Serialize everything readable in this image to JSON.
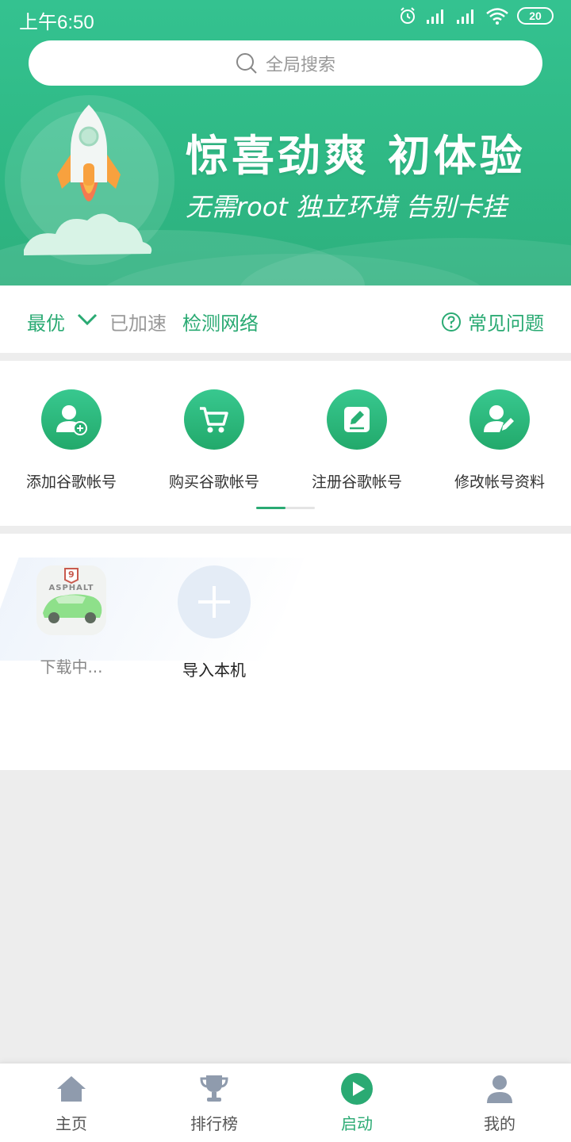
{
  "status_bar": {
    "time": "上午6:50",
    "battery": "20"
  },
  "search": {
    "placeholder": "全局搜索"
  },
  "banner": {
    "title": "惊喜劲爽  初体验",
    "subtitle": "无需root  独立环境  告别卡挂"
  },
  "network": {
    "mode": "最优",
    "status": "已加速",
    "check_label": "检测网络",
    "faq_label": "常见问题"
  },
  "actions": [
    {
      "label": "添加谷歌帐号",
      "icon": "add-user-icon"
    },
    {
      "label": "购买谷歌帐号",
      "icon": "cart-icon"
    },
    {
      "label": "注册谷歌帐号",
      "icon": "edit-icon"
    },
    {
      "label": "修改帐号资料",
      "icon": "edit-user-icon"
    }
  ],
  "apps": [
    {
      "label": "下载中...",
      "icon": "asphalt-icon",
      "badge": "9",
      "brand": "ASPHALT"
    },
    {
      "label": "导入本机",
      "icon": "plus-icon"
    }
  ],
  "tabs": [
    {
      "label": "主页",
      "icon": "home-icon"
    },
    {
      "label": "排行榜",
      "icon": "trophy-icon"
    },
    {
      "label": "启动",
      "icon": "play-icon",
      "active": true
    },
    {
      "label": "我的",
      "icon": "user-icon"
    }
  ],
  "colors": {
    "brand": "#2aaa73",
    "banner": "#34c290",
    "inactive_icon": "#8f9bad"
  }
}
